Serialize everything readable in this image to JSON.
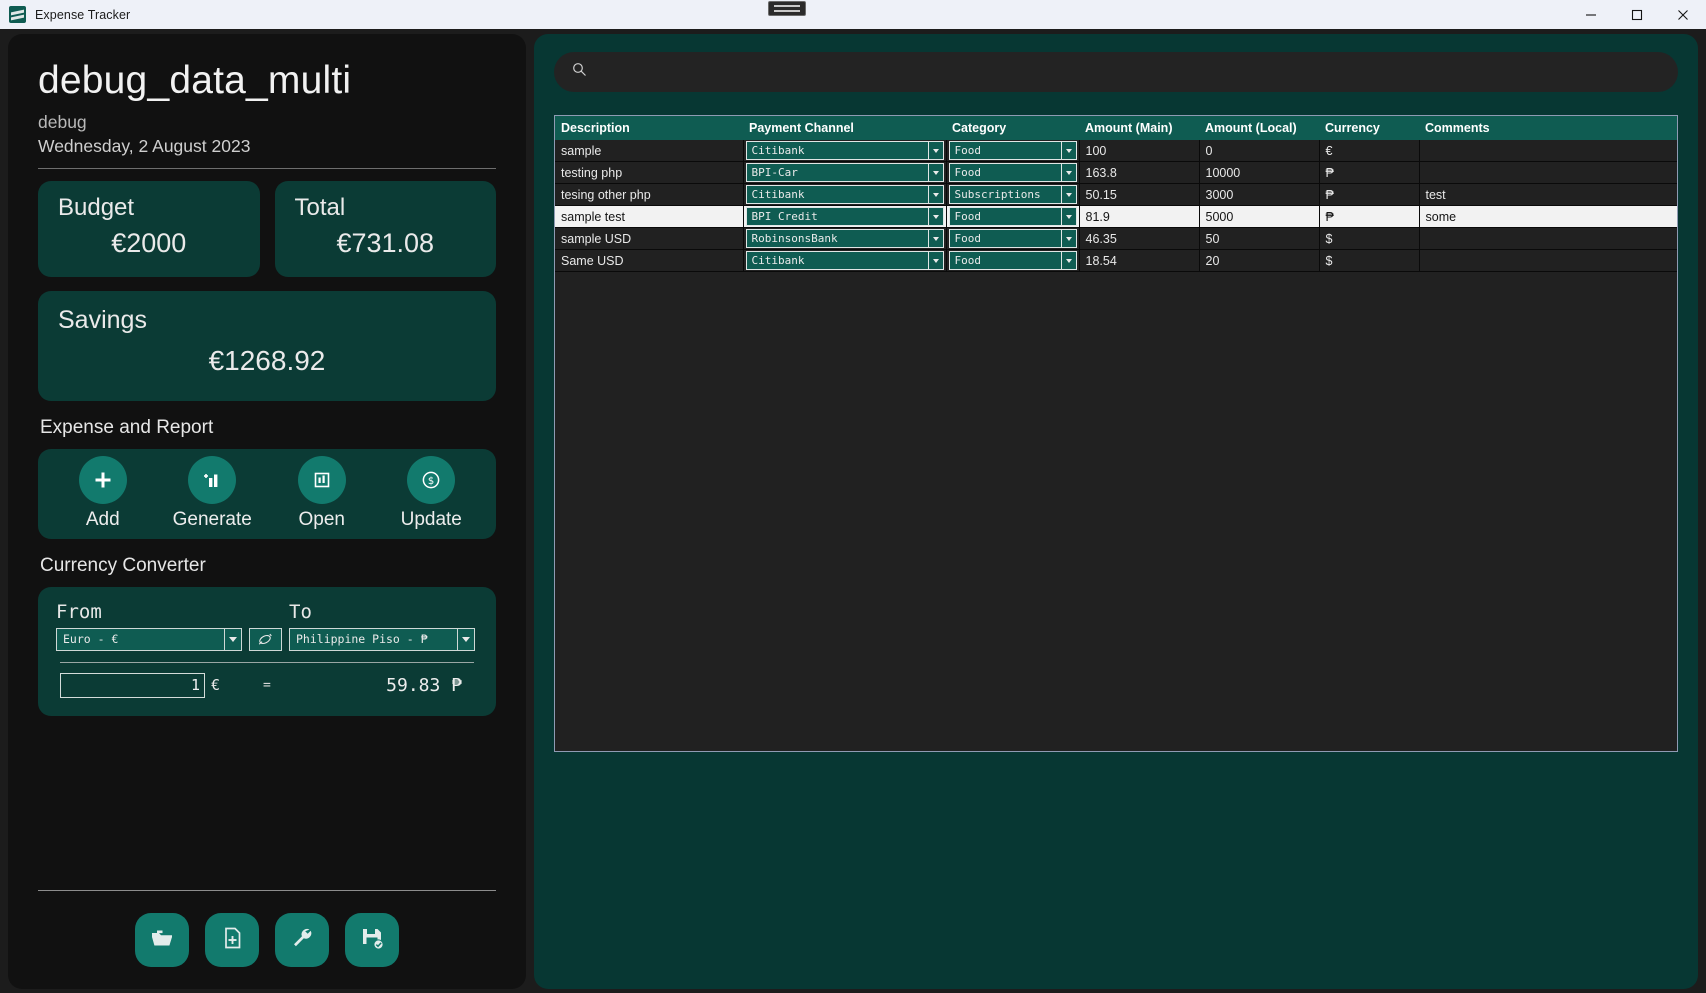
{
  "window": {
    "title": "Expense Tracker",
    "icon": "app-icon",
    "minimize": "—",
    "maximize": "□",
    "close": "✕"
  },
  "sidebar": {
    "project_title": "debug_data_multi",
    "project_subtitle": "debug",
    "project_date": "Wednesday, 2 August 2023",
    "cards": {
      "budget": {
        "label": "Budget",
        "value": "€2000"
      },
      "total": {
        "label": "Total",
        "value": "€731.08"
      },
      "savings": {
        "label": "Savings",
        "value": "€1268.92"
      }
    },
    "expense_section_title": "Expense and Report",
    "actions": [
      {
        "label": "Add",
        "icon": "plus-icon"
      },
      {
        "label": "Generate",
        "icon": "chart-add-icon"
      },
      {
        "label": "Open",
        "icon": "chart-icon"
      },
      {
        "label": "Update",
        "icon": "dollar-circle-icon"
      }
    ],
    "converter_section_title": "Currency Converter",
    "converter": {
      "from_label": "From",
      "to_label": "To",
      "from_value": "Euro - €",
      "to_value": "Philippine Piso - ₱",
      "swap_icon": "swap-icon",
      "amount_value": "1",
      "amount_currency": "€",
      "equals": "=",
      "result": "59.83 ₱"
    },
    "tools": [
      {
        "name": "open-folder-icon"
      },
      {
        "name": "new-file-icon"
      },
      {
        "name": "wrench-icon"
      },
      {
        "name": "save-check-icon"
      }
    ]
  },
  "main": {
    "search": {
      "placeholder": "",
      "value": "",
      "icon": "search-icon"
    },
    "table": {
      "columns": [
        "Description",
        "Payment Channel",
        "Category",
        "Amount (Main)",
        "Amount (Local)",
        "Currency",
        "Comments"
      ],
      "rows": [
        {
          "description": "sample",
          "payment_channel": "Citibank",
          "category": "Food",
          "amount_main": "100",
          "amount_local": "0",
          "currency": "€",
          "comments": "",
          "selected": false
        },
        {
          "description": "testing php",
          "payment_channel": "BPI-Car",
          "category": "Food",
          "amount_main": "163.8",
          "amount_local": "10000",
          "currency": "₱",
          "comments": "",
          "selected": false
        },
        {
          "description": "tesing other php",
          "payment_channel": "Citibank",
          "category": "Subscriptions",
          "amount_main": "50.15",
          "amount_local": "3000",
          "currency": "₱",
          "comments": "test",
          "selected": false
        },
        {
          "description": "sample test",
          "payment_channel": "BPI Credit",
          "category": "Food",
          "amount_main": "81.9",
          "amount_local": "5000",
          "currency": "₱",
          "comments": "some",
          "selected": true
        },
        {
          "description": "sample USD",
          "payment_channel": "RobinsonsBank",
          "category": "Food",
          "amount_main": "46.35",
          "amount_local": "50",
          "currency": "$",
          "comments": "",
          "selected": false
        },
        {
          "description": "Same USD",
          "payment_channel": "Citibank",
          "category": "Food",
          "amount_main": "18.54",
          "amount_local": "20",
          "currency": "$",
          "comments": "",
          "selected": false
        }
      ]
    }
  },
  "colors": {
    "accent_green": "#0f5c52",
    "panel_green": "#073733",
    "card_green": "#0b3b35",
    "circle_green": "#127a6d",
    "sidebar_bg": "#111111",
    "table_bg": "#212121",
    "selected_row": "#f2f2f2"
  }
}
